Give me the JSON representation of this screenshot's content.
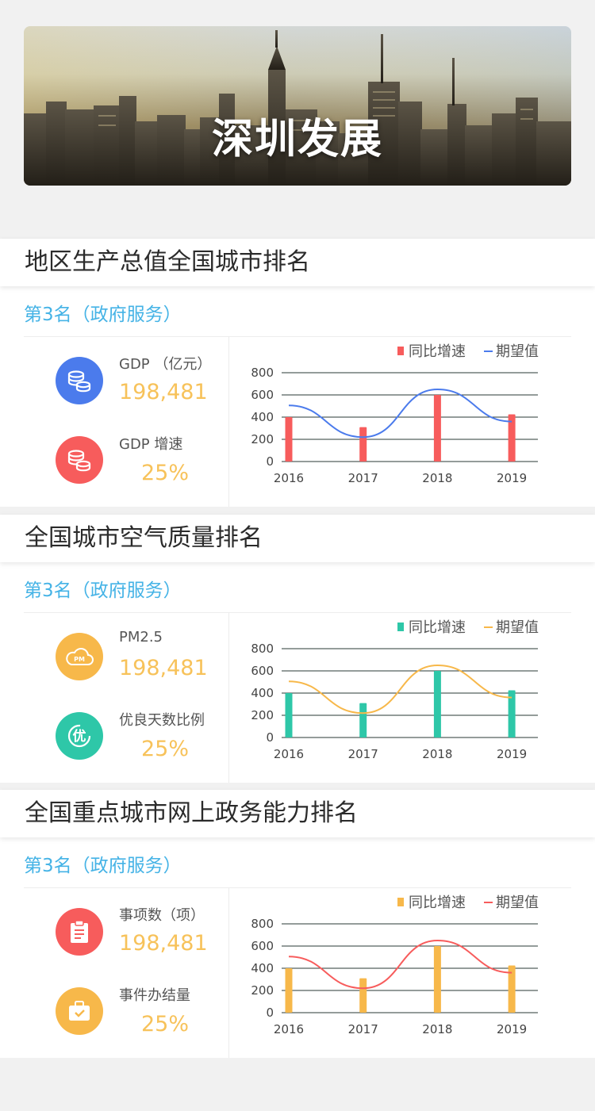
{
  "banner": {
    "title": "深圳发展"
  },
  "sections": [
    {
      "title": "地区生产总值全国城市排名",
      "rank": "第3名（政府服务）",
      "stats": [
        {
          "label": "GDP （亿元）",
          "value": "198,481",
          "icon": "coin-stack-icon",
          "color": "#4b7bec"
        },
        {
          "label": "GDP 增速",
          "value": "25%",
          "icon": "coin-stack-icon",
          "color": "#f75c5c"
        }
      ],
      "bar_color": "#f75c5c",
      "line_color": "#4b7bec"
    },
    {
      "title": "全国城市空气质量排名",
      "rank": "第3名（政府服务）",
      "stats": [
        {
          "label": "PM2.5",
          "value": "198,481",
          "icon": "pm-cloud-icon",
          "color": "#f7b84a"
        },
        {
          "label": "优良天数比例",
          "value": "25%",
          "icon": "excellent-badge-icon",
          "color": "#2ec7a8"
        }
      ],
      "bar_color": "#2ec7a8",
      "line_color": "#f7b84a"
    },
    {
      "title": "全国重点城市网上政务能力排名",
      "rank": "第3名（政府服务）",
      "stats": [
        {
          "label": "事项数（项）",
          "value": "198,481",
          "icon": "clipboard-icon",
          "color": "#f75c5c"
        },
        {
          "label": "事件办结量",
          "value": "25%",
          "icon": "briefcase-check-icon",
          "color": "#f7b84a"
        }
      ],
      "bar_color": "#f7b84a",
      "line_color": "#f75c5c"
    }
  ],
  "chart_data": [
    {
      "type": "bar",
      "categories": [
        "2016",
        "2017",
        "2018",
        "2019"
      ],
      "series": [
        {
          "name": "同比增速",
          "type": "bar",
          "values": [
            400,
            310,
            600,
            425
          ]
        },
        {
          "name": "期望值",
          "type": "line",
          "values": [
            505,
            220,
            650,
            360
          ]
        }
      ],
      "ylim": [
        0,
        800
      ],
      "yticks": [
        0,
        200,
        400,
        600,
        800
      ],
      "legend": "top-right",
      "grid": true
    },
    {
      "type": "bar",
      "categories": [
        "2016",
        "2017",
        "2018",
        "2019"
      ],
      "series": [
        {
          "name": "同比增速",
          "type": "bar",
          "values": [
            400,
            310,
            600,
            425
          ]
        },
        {
          "name": "期望值",
          "type": "line",
          "values": [
            505,
            220,
            650,
            360
          ]
        }
      ],
      "ylim": [
        0,
        800
      ],
      "yticks": [
        0,
        200,
        400,
        600,
        800
      ],
      "legend": "top-right",
      "grid": true
    },
    {
      "type": "bar",
      "categories": [
        "2016",
        "2017",
        "2018",
        "2019"
      ],
      "series": [
        {
          "name": "同比增速",
          "type": "bar",
          "values": [
            400,
            310,
            600,
            425
          ]
        },
        {
          "name": "期望值",
          "type": "line",
          "values": [
            505,
            220,
            650,
            360
          ]
        }
      ],
      "ylim": [
        0,
        800
      ],
      "yticks": [
        0,
        200,
        400,
        600,
        800
      ],
      "legend": "top-right",
      "grid": true
    }
  ]
}
